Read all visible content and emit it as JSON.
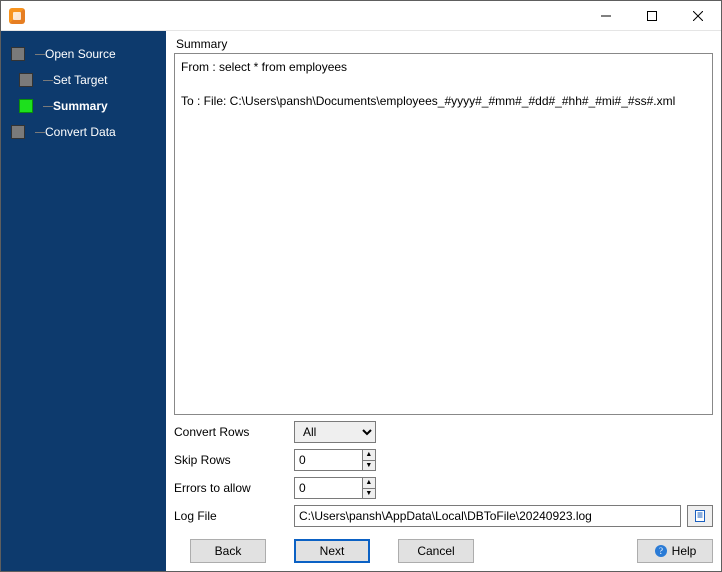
{
  "sidebar": {
    "items": [
      {
        "label": "Open Source",
        "indent": false,
        "active": false
      },
      {
        "label": "Set Target",
        "indent": true,
        "active": false
      },
      {
        "label": "Summary",
        "indent": true,
        "active": true
      },
      {
        "label": "Convert Data",
        "indent": false,
        "active": false
      }
    ]
  },
  "main": {
    "section_label": "Summary",
    "summary_lines": {
      "from": "From : select * from employees",
      "to": "To : File: C:\\Users\\pansh\\Documents\\employees_#yyyy#_#mm#_#dd#_#hh#_#mi#_#ss#.xml"
    },
    "form": {
      "convert_rows": {
        "label": "Convert Rows",
        "value": "All",
        "options": [
          "All"
        ]
      },
      "skip_rows": {
        "label": "Skip Rows",
        "value": "0"
      },
      "errors_allow": {
        "label": "Errors to allow",
        "value": "0"
      },
      "log_file": {
        "label": "Log File",
        "value": "C:\\Users\\pansh\\AppData\\Local\\DBToFile\\20240923.log"
      }
    }
  },
  "footer": {
    "back": "Back",
    "next": "Next",
    "cancel": "Cancel",
    "help": "Help"
  }
}
